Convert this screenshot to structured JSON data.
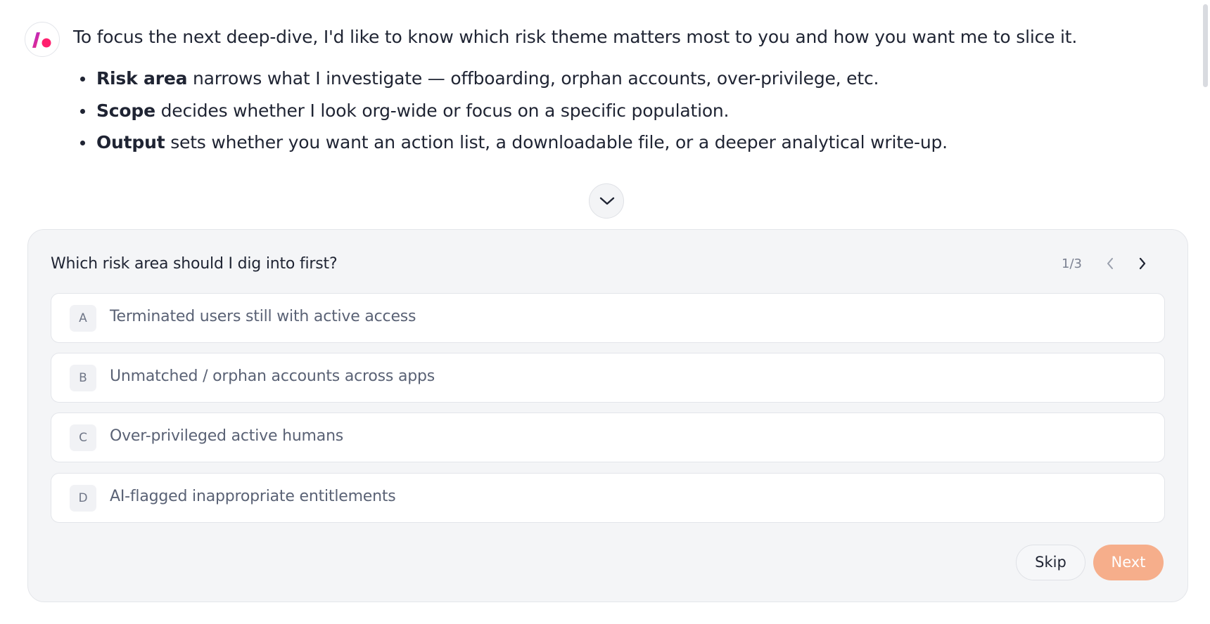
{
  "message": {
    "avatar_icon": "assistant-logo-icon",
    "intro": "To focus the next deep-dive, I'd like to know which risk theme matters most to you and how you want me to slice it.",
    "bullets": [
      {
        "term": "Risk area",
        "text": " narrows what I investigate — offboarding, orphan accounts, over-privilege, etc."
      },
      {
        "term": "Scope",
        "text": " decides whether I look org-wide or focus on a specific population."
      },
      {
        "term": "Output",
        "text": " sets whether you want an action list, a downloadable file, or a deeper analytical write-up."
      }
    ],
    "collapse_icon": "chevron-down-icon"
  },
  "question_card": {
    "question": "Which risk area should I dig into first?",
    "pager": {
      "count": "1/3",
      "prev_icon": "chevron-left-icon",
      "next_icon": "chevron-right-icon"
    },
    "options": [
      {
        "letter": "A",
        "label": "Terminated users still with active access"
      },
      {
        "letter": "B",
        "label": "Unmatched / orphan accounts across apps"
      },
      {
        "letter": "C",
        "label": "Over-privileged active humans"
      },
      {
        "letter": "D",
        "label": "AI-flagged inappropriate entitlements"
      }
    ],
    "skip_label": "Skip",
    "next_label": "Next"
  },
  "colors": {
    "accent_next": "#f6ae8b",
    "logo_pink": "#e8197d"
  }
}
